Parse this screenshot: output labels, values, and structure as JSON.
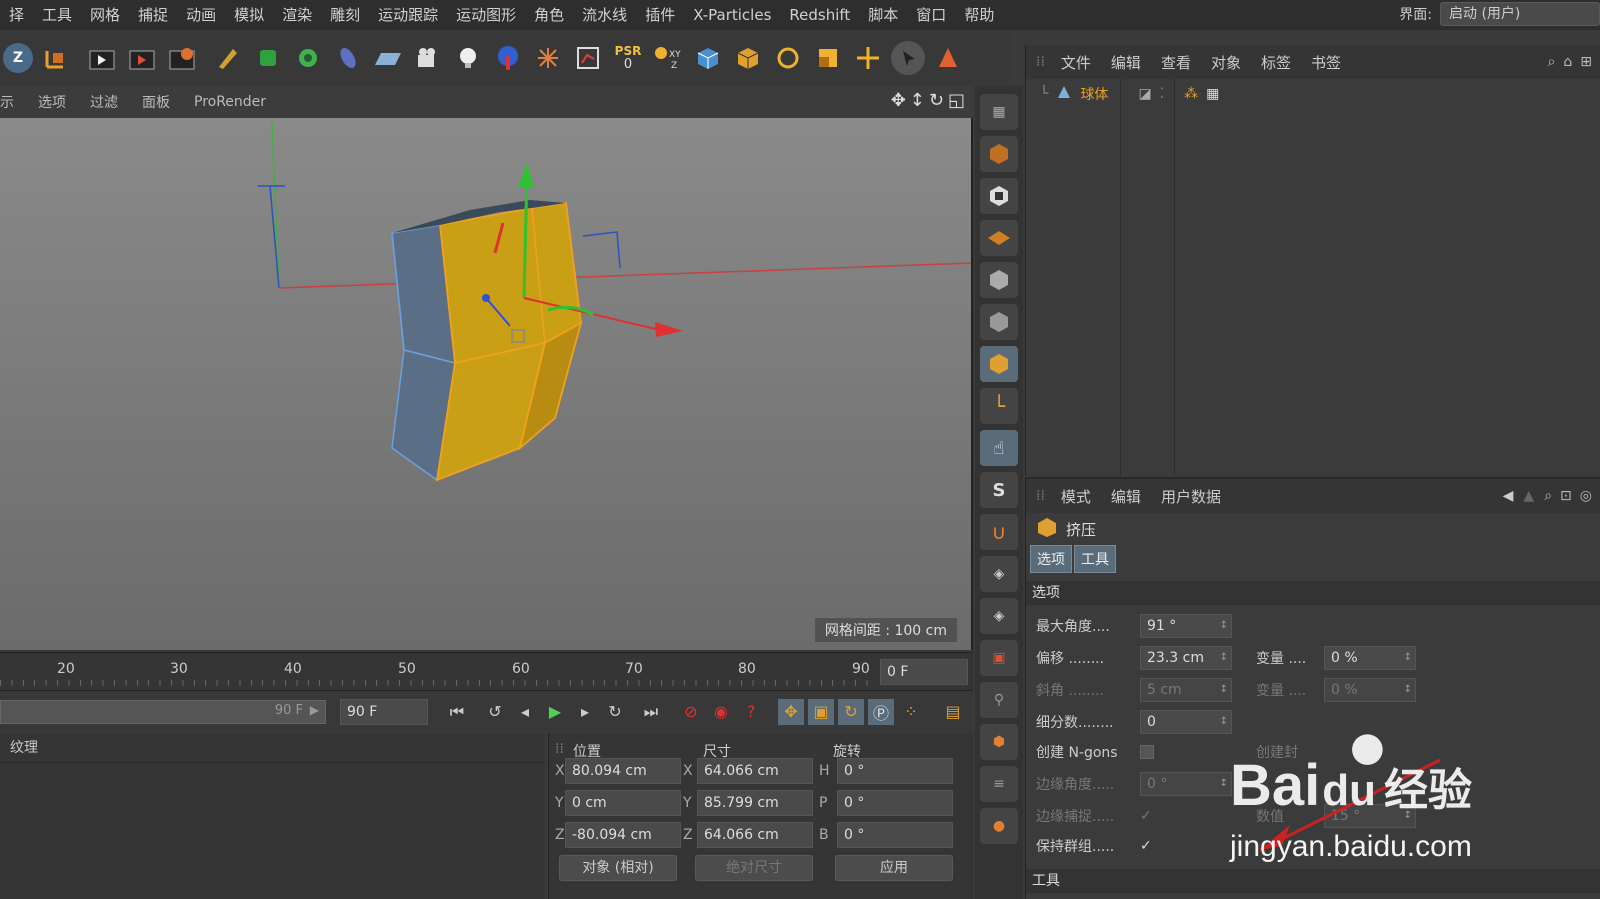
{
  "menubar": {
    "items": [
      "择",
      "工具",
      "网格",
      "捕捉",
      "动画",
      "模拟",
      "渲染",
      "雕刻",
      "运动跟踪",
      "运动图形",
      "角色",
      "流水线",
      "插件",
      "X-Particles",
      "Redshift",
      "脚本",
      "窗口",
      "帮助"
    ],
    "interface_label": "界面:",
    "interface_value": "启动 (用户)"
  },
  "toolbar": {
    "icons": [
      "axis-z-icon",
      "coord-icon",
      "object-icon",
      "render-view-icon",
      "render-picture-icon",
      "render-settings-icon",
      "pen-icon",
      "cube-generator-icon",
      "mograph-icon",
      "spline-icon",
      "floor-icon",
      "camera-icon",
      "light-icon",
      "deformer-icon",
      "explode-icon",
      "timeline-icon",
      "psr-icon",
      "xyz-icon",
      "cube-icon",
      "box-icon",
      "rotate-icon",
      "scale-icon",
      "move-icon",
      "select-icon",
      "points-icon"
    ],
    "psr_label": "PSR",
    "psr_value": "0"
  },
  "viewport_menu": {
    "items": [
      "示",
      "选项",
      "过滤",
      "面板",
      "ProRender"
    ]
  },
  "viewport": {
    "grid_label": "网格间距 : 100 cm"
  },
  "object_manager": {
    "menu": [
      "文件",
      "编辑",
      "查看",
      "对象",
      "标签",
      "书签"
    ],
    "object_name": "球体"
  },
  "attribute_manager": {
    "menu": [
      "模式",
      "编辑",
      "用户数据"
    ],
    "title": "挤压",
    "tabs": [
      "选项",
      "工具"
    ],
    "section_options": "选项",
    "section_tools": "工具",
    "props": {
      "max_angle_label": "最大角度....",
      "max_angle_value": "91 °",
      "offset_label": "偏移 ........",
      "offset_value": "23.3 cm",
      "var1_label": "变量 ....",
      "var1_value": "0 %",
      "bevel_label": "斜角 ........",
      "bevel_value": "5 cm",
      "var2_label": "变量 ....",
      "var2_value": "0 %",
      "subdiv_label": "细分数........",
      "subdiv_value": "0",
      "ngons_label": "创建 N-gons",
      "caps_label": "创建封",
      "edge_angle_label": "边缘角度.....",
      "edge_angle_value": "0 °",
      "edge_snap_label": "边缘捕捉.....",
      "count_label": "数值",
      "count_value": "15 °",
      "keep_groups_label": "保持群组.....",
      "keep_groups_checked": "✓"
    }
  },
  "timeline": {
    "ticks": [
      "20",
      "30",
      "40",
      "50",
      "60",
      "70",
      "80",
      "90"
    ],
    "current_frame": "0 F"
  },
  "transport": {
    "end_frame_slider": "90 F",
    "end_frame": "90 F"
  },
  "material_panel": {
    "tab_label": "纹理"
  },
  "coordinates": {
    "headers": [
      "位置",
      "尺寸",
      "旋转"
    ],
    "pos_x": "80.094 cm",
    "pos_y": "0 cm",
    "pos_z": "-80.094 cm",
    "size_x": "64.066 cm",
    "size_y": "85.799 cm",
    "size_z": "64.066 cm",
    "rot_h": "0 °",
    "rot_p": "0 °",
    "rot_b": "0 °",
    "axis_labels": [
      "X",
      "Y",
      "Z"
    ],
    "rot_labels": [
      "H",
      "P",
      "B"
    ],
    "mode_select": "对象 (相对)",
    "size_select": "绝对尺寸",
    "apply_button": "应用"
  },
  "watermark": {
    "brand": "Bai",
    "brand2": "经验",
    "url": "jingyan.baidu.com"
  },
  "colors": {
    "selection_orange": "#f0a020",
    "extrude_yellow": "#c89a10",
    "axis_red": "#e03030",
    "axis_green": "#30c030",
    "axis_blue": "#3050e0"
  }
}
